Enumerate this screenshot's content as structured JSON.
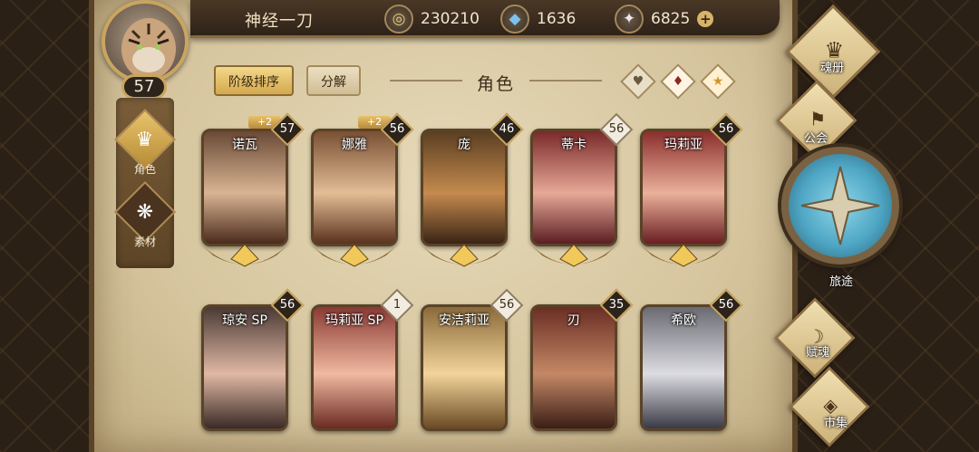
{
  "player": {
    "name": "神经一刀",
    "level": "57"
  },
  "currency": {
    "coins": "230210",
    "crystals": "1636",
    "gems": "6825",
    "plus": "+"
  },
  "left_nav": [
    {
      "label": "角色"
    },
    {
      "label": "素材"
    }
  ],
  "tabs": {
    "sort": "阶级排序",
    "decompose": "分解"
  },
  "page_title": "角色",
  "filters": [
    "heart-icon",
    "fire-icon",
    "star-icon"
  ],
  "characters": [
    {
      "name": "诺瓦",
      "level": "57",
      "bonus": "+2"
    },
    {
      "name": "娜雅",
      "level": "56",
      "bonus": "+2"
    },
    {
      "name": "庞",
      "level": "46",
      "bonus": ""
    },
    {
      "name": "蒂卡",
      "level": "56",
      "bonus": ""
    },
    {
      "name": "玛莉亚",
      "level": "56",
      "bonus": ""
    },
    {
      "name": "琼安 SP",
      "level": "56",
      "bonus": ""
    },
    {
      "name": "玛莉亚 SP",
      "level": "1",
      "bonus": ""
    },
    {
      "name": "安洁莉亚",
      "level": "56",
      "bonus": ""
    },
    {
      "name": "刃",
      "level": "35",
      "bonus": ""
    },
    {
      "name": "希欧",
      "level": "56",
      "bonus": ""
    }
  ],
  "right_nav": {
    "soulbook": "魂册",
    "guild": "公会",
    "journey": "旅途",
    "soul_grant": "赋魂",
    "market": "市集"
  }
}
